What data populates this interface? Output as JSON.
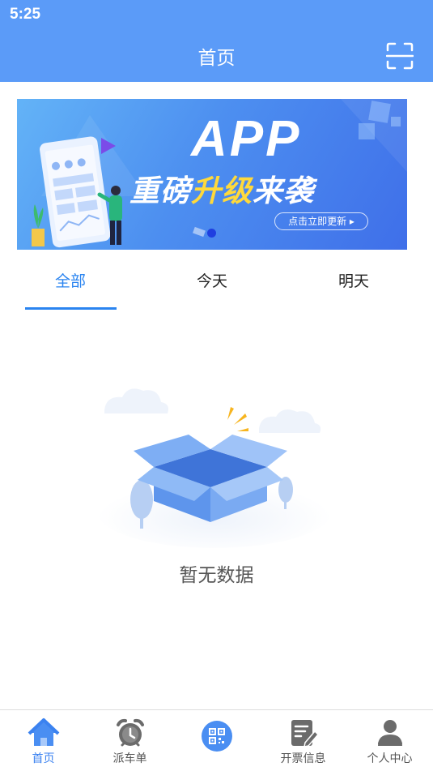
{
  "status_bar": {
    "time": "5:25"
  },
  "header": {
    "title": "首页",
    "scan_icon": "scan-icon"
  },
  "banner": {
    "title": "APP",
    "subtitle_part1": "重磅",
    "subtitle_highlight": "升级",
    "subtitle_part2": "来袭",
    "button_label": "点击立即更新 ▸"
  },
  "tabs": [
    {
      "label": "全部",
      "active": true
    },
    {
      "label": "今天",
      "active": false
    },
    {
      "label": "明天",
      "active": false
    }
  ],
  "empty_state": {
    "text": "暂无数据"
  },
  "bottom_nav": [
    {
      "label": "首页",
      "icon": "home-icon",
      "active": true
    },
    {
      "label": "派车单",
      "icon": "alarm-clock-icon",
      "active": false
    },
    {
      "label": "",
      "icon": "qr-code-icon",
      "active": false
    },
    {
      "label": "开票信息",
      "icon": "invoice-edit-icon",
      "active": false
    },
    {
      "label": "个人中心",
      "icon": "user-icon",
      "active": false
    }
  ],
  "colors": {
    "header": "#5b9bf8",
    "accent": "#2a84f0",
    "nav_inactive": "#555555"
  }
}
